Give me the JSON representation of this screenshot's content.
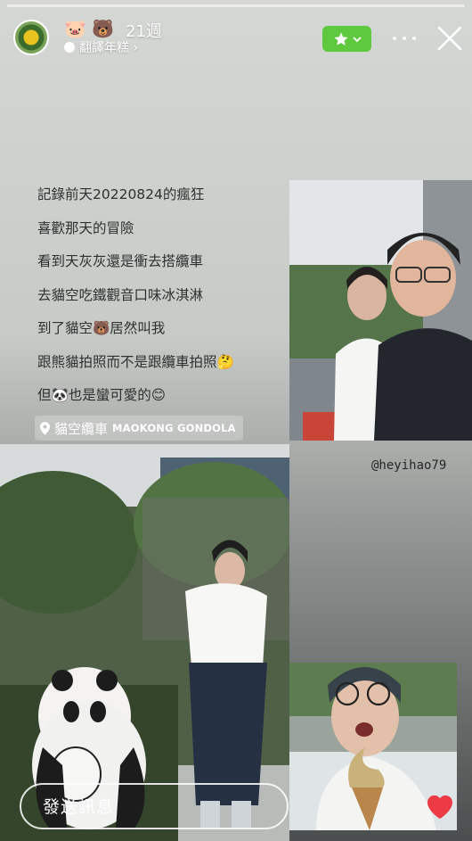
{
  "story": {
    "progress": 1.0
  },
  "header": {
    "user_emojis": "🐷 🐻",
    "post_age": "21週",
    "music_label": "翻譯年糕 ›"
  },
  "caption": {
    "lines": [
      "記錄前天20220824的瘋狂",
      "喜歡那天的冒險",
      "看到天灰灰還是衝去搭纜車",
      "去貓空吃鐵觀音口味冰淇淋",
      "到了貓空🐻居然叫我",
      "跟熊貓拍照而不是跟纜車拍照🤔",
      "但🐼也是蠻可愛的😊"
    ]
  },
  "location": {
    "name": "貓空纜車",
    "subtitle": "MAOKONG GONDOLA"
  },
  "photo_tag": {
    "handle": "@heyihao79"
  },
  "footer": {
    "send_placeholder": "發送訊息"
  },
  "colors": {
    "accent_green": "#5ec83f",
    "heart_red": "#ed3b45"
  }
}
